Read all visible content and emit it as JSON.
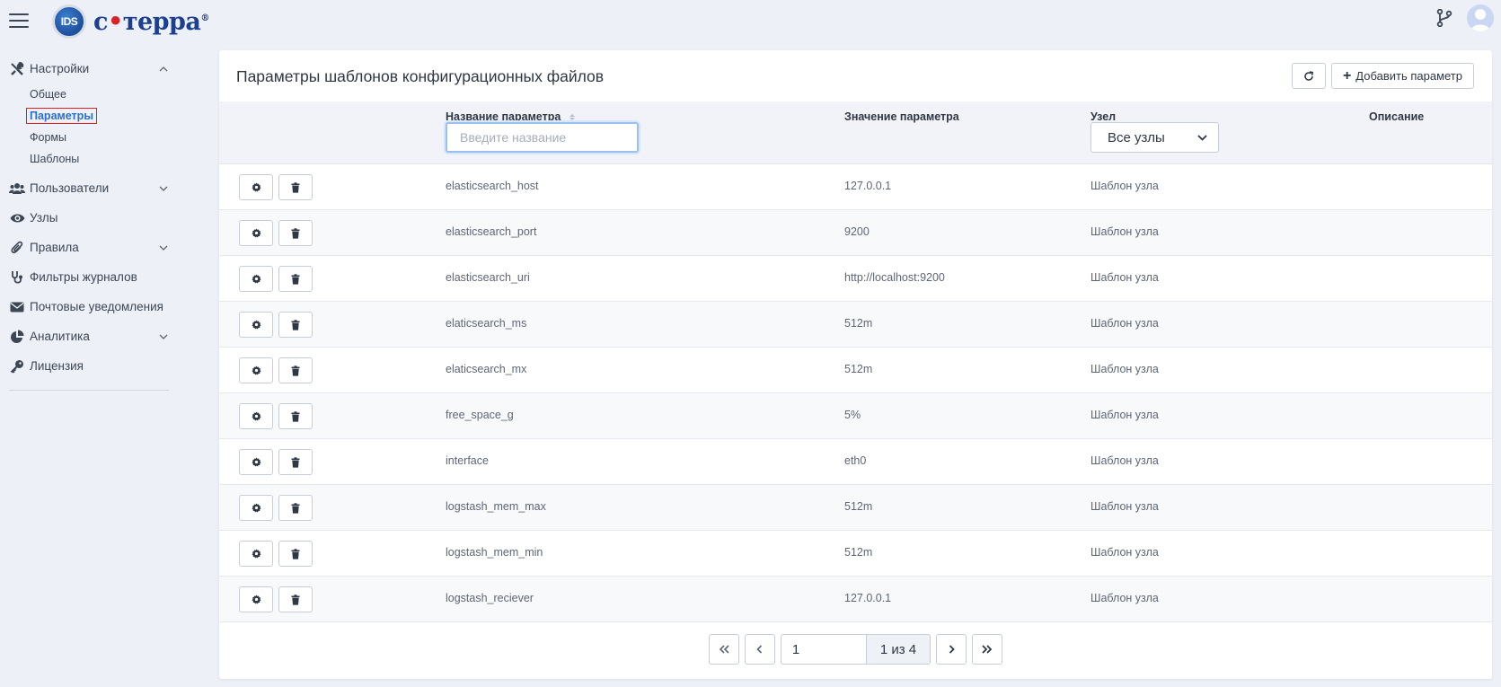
{
  "header": {
    "logo_badge": "IDS",
    "logo_text_1": "с",
    "logo_dot": "•",
    "logo_text_2": "терра",
    "logo_reg": "®"
  },
  "sidebar": {
    "items": [
      {
        "label": "Настройки",
        "icon": "tools-icon",
        "expanded": true
      },
      {
        "label": "Пользователи",
        "icon": "users-icon"
      },
      {
        "label": "Узлы",
        "icon": "eye-icon"
      },
      {
        "label": "Правила",
        "icon": "paperclip-icon"
      },
      {
        "label": "Фильтры журналов",
        "icon": "stethoscope-icon"
      },
      {
        "label": "Почтовые уведомления",
        "icon": "envelope-icon"
      },
      {
        "label": "Аналитика",
        "icon": "pie-chart-icon"
      },
      {
        "label": "Лицензия",
        "icon": "key-icon"
      }
    ],
    "settings_sub": [
      {
        "label": "Общее"
      },
      {
        "label": "Параметры",
        "active": true
      },
      {
        "label": "Формы"
      },
      {
        "label": "Шаблоны"
      }
    ]
  },
  "page": {
    "title": "Параметры шаблонов конфигурационных файлов",
    "add_button": "Добавить параметр",
    "columns": {
      "name": "Название параметра",
      "value": "Значение параметра",
      "node": "Узел",
      "description": "Описание"
    },
    "name_filter_placeholder": "Введите название",
    "node_filter_value": "Все узлы",
    "rows": [
      {
        "name": "elasticsearch_host",
        "value": "127.0.0.1",
        "node": "Шаблон узла",
        "description": ""
      },
      {
        "name": "elasticsearch_port",
        "value": "9200",
        "node": "Шаблон узла",
        "description": ""
      },
      {
        "name": "elasticsearch_uri",
        "value": "http://localhost:9200",
        "node": "Шаблон узла",
        "description": ""
      },
      {
        "name": "elaticsearch_ms",
        "value": "512m",
        "node": "Шаблон узла",
        "description": ""
      },
      {
        "name": "elaticsearch_mx",
        "value": "512m",
        "node": "Шаблон узла",
        "description": ""
      },
      {
        "name": "free_space_g",
        "value": "5%",
        "node": "Шаблон узла",
        "description": ""
      },
      {
        "name": "interface",
        "value": "eth0",
        "node": "Шаблон узла",
        "description": ""
      },
      {
        "name": "logstash_mem_max",
        "value": "512m",
        "node": "Шаблон узла",
        "description": ""
      },
      {
        "name": "logstash_mem_min",
        "value": "512m",
        "node": "Шаблон узла",
        "description": ""
      },
      {
        "name": "logstash_reciever",
        "value": "127.0.0.1",
        "node": "Шаблон узла",
        "description": ""
      }
    ],
    "pagination": {
      "current_page": "1",
      "total_label": "1 из 4"
    }
  },
  "colors": {
    "background": "#edf0f7",
    "accent": "#2a6fd0",
    "highlight_border": "#e02020",
    "logo_blue": "#1c3f8f",
    "logo_red": "#d8232a"
  }
}
